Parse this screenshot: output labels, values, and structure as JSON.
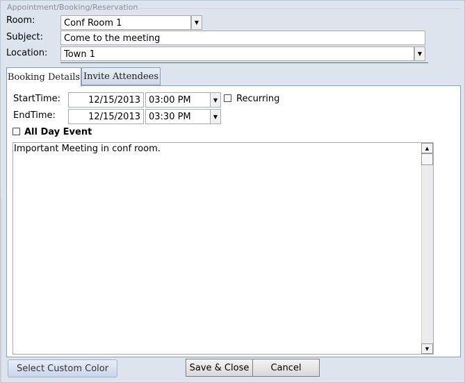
{
  "window": {
    "title": "Appointment/Booking/Reservation"
  },
  "form": {
    "room_label": "Room:",
    "room_value": "Conf Room 1",
    "subject_label": "Subject:",
    "subject_value": "Come to the meeting",
    "location_label": "Location:",
    "location_value": "Town 1"
  },
  "tabs": [
    {
      "label": "Booking Details",
      "active": true
    },
    {
      "label": "Invite Attendees",
      "active": false
    }
  ],
  "booking": {
    "start_label": "StartTime:",
    "start_date": "12/15/2013",
    "start_time": "03:00 PM",
    "end_label": "EndTime:",
    "end_date": "12/15/2013",
    "end_time": "03:30 PM",
    "recurring_label": "Recurring",
    "recurring_checked": false,
    "all_day_label": "All Day Event",
    "all_day_checked": false,
    "notes": "Important Meeting in conf room."
  },
  "buttons": {
    "custom_color": "Select Custom Color",
    "save_close": "Save & Close",
    "cancel": "Cancel"
  },
  "icons": {
    "dropdown": "chevron-down-icon",
    "scroll_up": "arrow-up-icon",
    "scroll_down": "arrow-down-icon"
  }
}
